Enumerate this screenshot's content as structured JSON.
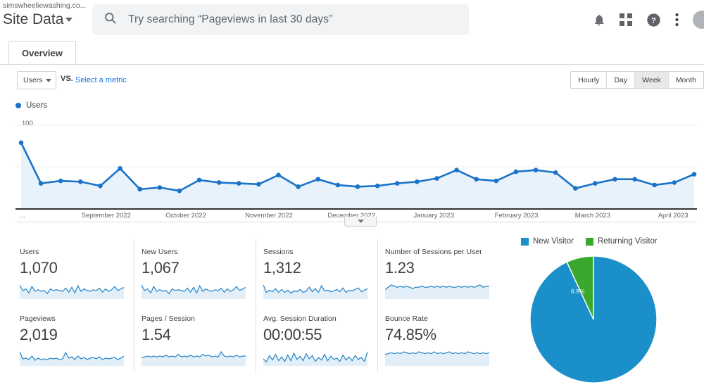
{
  "header": {
    "account_name": "simswheeliewashing.co...",
    "property_name": "Site Data",
    "property_caret": "caret-down-icon",
    "search": {
      "icon": "search-icon",
      "placeholder": "Try searching “Pageviews in last 30 days”",
      "value": ""
    },
    "icons": [
      {
        "name": "notifications-bell-icon",
        "glyph": "bell"
      },
      {
        "name": "apps-grid-icon",
        "glyph": "grid"
      },
      {
        "name": "help-circle-icon",
        "glyph": "help"
      },
      {
        "name": "more-vertical-icon",
        "glyph": "dots"
      },
      {
        "name": "user-avatar",
        "glyph": "avatar"
      }
    ]
  },
  "tabs": [
    {
      "label": "Overview",
      "active": true
    }
  ],
  "controls": {
    "metric_select": {
      "label": "Users",
      "caret": "caret-down-icon"
    },
    "vs_label": "VS.",
    "select_metric_link": "Select a metric",
    "granularity": {
      "options": [
        "Hourly",
        "Day",
        "Week",
        "Month"
      ],
      "selected": "Week"
    }
  },
  "chart_legend": [
    {
      "label": "Users",
      "color": "#1a73c8"
    }
  ],
  "chart_data": {
    "type": "line",
    "title": "Users",
    "xlabel": "",
    "ylabel": "Users",
    "ylim": [
      0,
      100
    ],
    "yticks": [
      50,
      100
    ],
    "grid": true,
    "x_axis_ellipsis": "...",
    "tick_labels": [
      "September 2022",
      "October 2022",
      "November 2022",
      "December 2022",
      "January 2023",
      "February 2023",
      "March 2023",
      "April 2023"
    ],
    "tick_positions_pct": [
      13.3,
      25.0,
      37.2,
      49.3,
      61.4,
      73.5,
      84.7,
      96.5
    ],
    "series": [
      {
        "name": "Users",
        "color": "#1a73c8",
        "fill": "#e8f2fa",
        "values": [
          79,
          30,
          33,
          32,
          27,
          48,
          23,
          25,
          21,
          34,
          31,
          30,
          29,
          40,
          26,
          35,
          28,
          26,
          27,
          30,
          32,
          36,
          46,
          35,
          33,
          44,
          46,
          43,
          24,
          30,
          35,
          35,
          28,
          31,
          41
        ]
      }
    ],
    "collapse_handle": "chevron-down-icon"
  },
  "metric_cards": [
    {
      "label": "Users",
      "value": "1,070",
      "spark": [
        16,
        9,
        11,
        6,
        14,
        8,
        10,
        8,
        9,
        5,
        11,
        9,
        10,
        9,
        8,
        12,
        7,
        13,
        6,
        15,
        8,
        11,
        9,
        8,
        10,
        9,
        12,
        7,
        11,
        8,
        10,
        14,
        9,
        11,
        13
      ]
    },
    {
      "label": "New Users",
      "value": "1,067",
      "spark": [
        16,
        9,
        11,
        6,
        14,
        8,
        10,
        8,
        9,
        5,
        11,
        9,
        10,
        9,
        8,
        12,
        7,
        13,
        6,
        15,
        8,
        11,
        9,
        8,
        10,
        9,
        12,
        7,
        11,
        8,
        10,
        14,
        9,
        11,
        13
      ]
    },
    {
      "label": "Sessions",
      "value": "1,312",
      "spark": [
        17,
        7,
        10,
        8,
        12,
        7,
        11,
        7,
        10,
        6,
        9,
        8,
        11,
        7,
        9,
        14,
        8,
        12,
        7,
        16,
        9,
        10,
        8,
        9,
        11,
        8,
        13,
        7,
        10,
        9,
        11,
        13,
        8,
        10,
        12
      ]
    },
    {
      "label": "Number of Sessions per User",
      "value": "1.23",
      "spark": [
        7,
        9,
        11,
        10,
        9,
        10,
        9,
        10,
        9,
        8,
        9,
        9,
        10,
        9,
        9,
        10,
        9,
        10,
        9,
        10,
        9,
        10,
        9,
        9,
        10,
        9,
        10,
        9,
        10,
        9,
        10,
        11,
        9,
        10,
        10
      ]
    },
    {
      "label": "Pageviews",
      "value": "2,019",
      "spark": [
        18,
        8,
        9,
        7,
        12,
        6,
        9,
        7,
        8,
        7,
        9,
        8,
        9,
        7,
        8,
        17,
        9,
        11,
        7,
        12,
        8,
        10,
        7,
        9,
        10,
        8,
        11,
        7,
        9,
        8,
        9,
        10,
        7,
        9,
        12
      ]
    },
    {
      "label": "Pages / Session",
      "value": "1.54",
      "spark": [
        8,
        9,
        10,
        9,
        10,
        9,
        10,
        9,
        11,
        9,
        10,
        9,
        12,
        9,
        10,
        9,
        11,
        9,
        10,
        9,
        12,
        10,
        11,
        9,
        10,
        9,
        15,
        10,
        9,
        10,
        9,
        11,
        9,
        10,
        10
      ]
    },
    {
      "label": "Avg. Session Duration",
      "value": "00:00:55",
      "spark": [
        9,
        4,
        14,
        7,
        16,
        6,
        12,
        5,
        15,
        6,
        18,
        8,
        13,
        6,
        17,
        9,
        14,
        5,
        11,
        7,
        16,
        6,
        13,
        8,
        10,
        5,
        15,
        7,
        12,
        6,
        14,
        8,
        11,
        5,
        20
      ]
    },
    {
      "label": "Bounce Rate",
      "value": "74.85%",
      "spark": [
        11,
        12,
        13,
        12,
        13,
        12,
        14,
        13,
        12,
        13,
        12,
        14,
        13,
        12,
        13,
        12,
        14,
        12,
        13,
        12,
        13,
        14,
        12,
        13,
        12,
        13,
        12,
        14,
        13,
        12,
        13,
        12,
        13,
        12,
        13
      ]
    }
  ],
  "pie_chart": {
    "type": "pie",
    "title": "",
    "legend_position": "top",
    "labels": [
      "New Visitor",
      "Returning Visitor"
    ],
    "colors": [
      "#1a8fc9",
      "#3aa82d"
    ],
    "values": [
      93.1,
      6.9
    ],
    "value_labels": [
      "93.1%",
      "6.9%"
    ]
  }
}
